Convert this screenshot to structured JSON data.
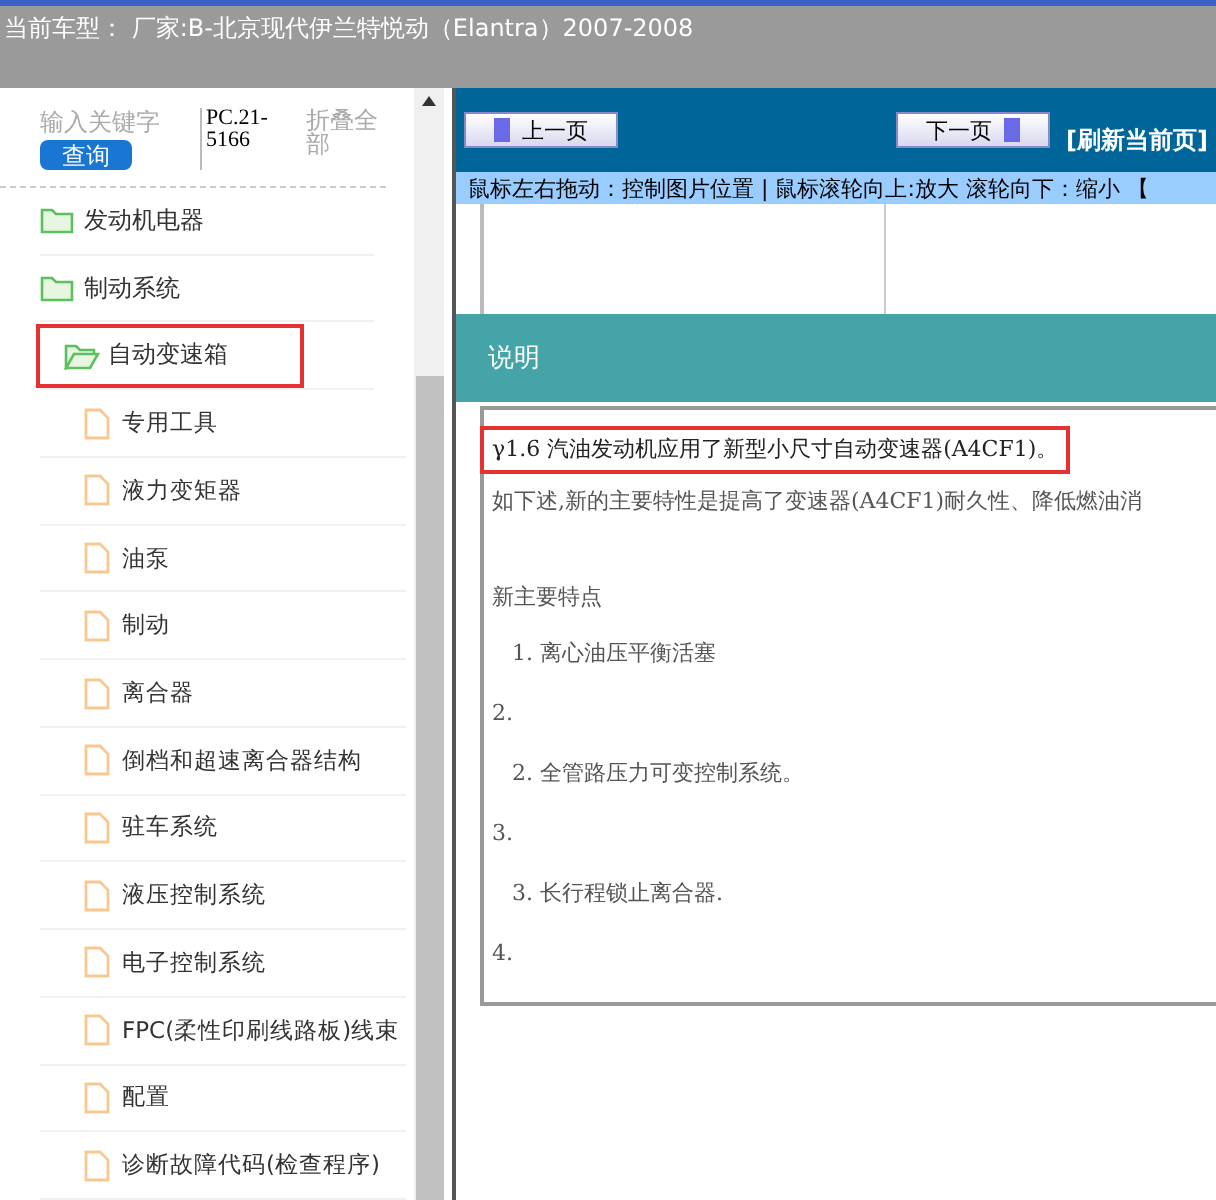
{
  "header": {
    "title": "当前车型： 厂家:B-北京现代伊兰特悦动（Elantra）2007-2008"
  },
  "sidebar": {
    "search": {
      "placeholder": "输入关键字",
      "button": "查询",
      "code": "PC.21-5166",
      "collapse": "折叠全部"
    },
    "tree": [
      {
        "label": "发动机电器",
        "expanded": false,
        "highlighted": false
      },
      {
        "label": "制动系统",
        "expanded": false,
        "highlighted": false
      },
      {
        "label": "自动变速箱",
        "expanded": true,
        "highlighted": true,
        "children": [
          {
            "label": "专用工具"
          },
          {
            "label": "液力变矩器"
          },
          {
            "label": "油泵"
          },
          {
            "label": "制动"
          },
          {
            "label": "离合器"
          },
          {
            "label": "倒档和超速离合器结构"
          },
          {
            "label": "驻车系统"
          },
          {
            "label": "液压控制系统"
          },
          {
            "label": "电子控制系统"
          },
          {
            "label": "FPC(柔性印刷线路板)线束"
          },
          {
            "label": "配置"
          },
          {
            "label": "诊断故障代码(检查程序)"
          }
        ]
      }
    ]
  },
  "toolbar": {
    "prev": "上一页",
    "next": "下一页",
    "refresh": "[刷新当前页]"
  },
  "hint": "鼠标左右拖动：控制图片位置 | 鼠标滚轮向上:放大   滚轮向下：缩小 【",
  "document": {
    "heading": "说明",
    "lines": [
      {
        "text": "γ1.6 汽油发动机应用了新型小尺寸自动变速器(A4CF1)。",
        "kind": "para",
        "highlighted": true
      },
      {
        "text": "如下述,新的主要特性是提高了变速器(A4CF1)耐久性、降低燃油消",
        "kind": "para",
        "highlighted": false
      },
      {
        "text": "新主要特点",
        "kind": "subhead",
        "highlighted": false
      },
      {
        "text": "1. 离心油压平衡活塞",
        "kind": "item",
        "highlighted": false
      },
      {
        "text": "2.",
        "kind": "number",
        "highlighted": false
      },
      {
        "text": "2. 全管路压力可变控制系统。",
        "kind": "item",
        "highlighted": false
      },
      {
        "text": "3.",
        "kind": "number",
        "highlighted": false
      },
      {
        "text": "3. 长行程锁止离合器.",
        "kind": "item",
        "highlighted": false
      },
      {
        "text": "4.",
        "kind": "number",
        "highlighted": false
      }
    ]
  }
}
